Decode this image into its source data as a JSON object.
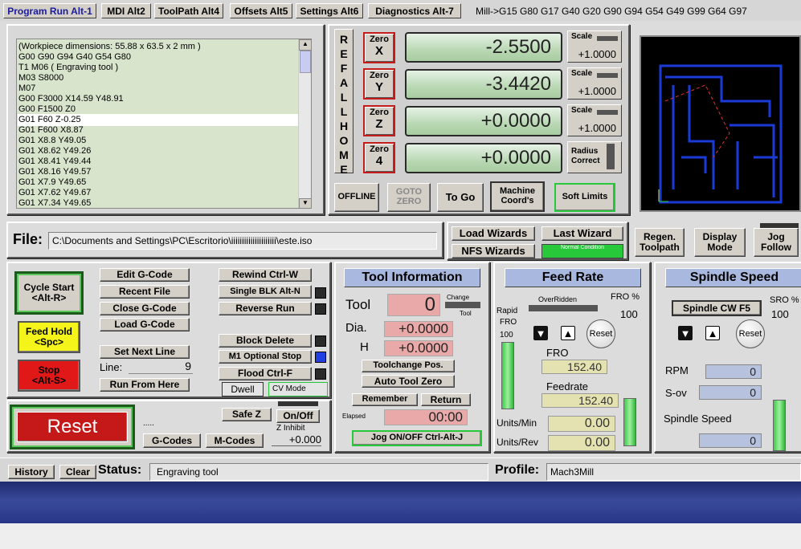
{
  "tabs": [
    {
      "label": "Program Run Alt-1"
    },
    {
      "label": "MDI Alt2"
    },
    {
      "label": "ToolPath Alt4"
    },
    {
      "label": "Offsets Alt5"
    },
    {
      "label": "Settings Alt6"
    },
    {
      "label": "Diagnostics Alt-7"
    }
  ],
  "modal_line": "Mill->G15  G80 G17 G40 G20 G90 G94 G54 G49 G99 G64 G97",
  "gcode_lines": [
    "(Workpiece dimensions: 55.88 x 63.5 x 2 mm )",
    "G00 G90 G94 G40 G54 G80",
    "T1 M06 ( Engraving tool )",
    "M03 S8000",
    "M07",
    "G00 F3000 X14.59 Y48.91",
    "G00 F1500 Z0",
    "G01 F60 Z-0.25",
    "G01 F600 X8.87",
    "G01 X8.8 Y49.05",
    "G01 X8.62 Y49.26",
    "G01 X8.41 Y49.44",
    "G01 X8.16 Y49.57",
    "G01 X7.9 Y49.65",
    "G01 X7.62 Y49.67",
    "G01 X7.34 Y49.65"
  ],
  "ref_all_home": [
    "R",
    "E",
    "F",
    "A",
    "L",
    "L",
    "H",
    "O",
    "M",
    "E"
  ],
  "axes": [
    {
      "zero_top": "Zero",
      "zero_axis": "X",
      "dro": "-2.5500",
      "scale_label": "Scale",
      "scale_value": "+1.0000"
    },
    {
      "zero_top": "Zero",
      "zero_axis": "Y",
      "dro": "-3.4420",
      "scale_label": "Scale",
      "scale_value": "+1.0000"
    },
    {
      "zero_top": "Zero",
      "zero_axis": "Z",
      "dro": "+0.0000",
      "scale_label": "Scale",
      "scale_value": "+1.0000"
    },
    {
      "zero_top": "Zero",
      "zero_axis": "4",
      "dro": "+0.0000",
      "scale_label": "",
      "scale_value": ""
    }
  ],
  "radius_correct": "Radius Correct",
  "dro_buttons": {
    "offline": "OFFLINE",
    "goto_zero": "GOTO ZERO",
    "to_go": "To Go",
    "machine_coords": "Machine Coord's",
    "soft_limits": "Soft Limits"
  },
  "file": {
    "label": "File:",
    "path": "C:\\Documents and Settings\\PC\\Escritorio\\iiiiiiiiiiiiiiiiiiiii\\este.iso"
  },
  "wizards": {
    "load": "Load Wizards",
    "last": "Last Wizard",
    "nfs": "NFS Wizards",
    "normal": "Normal Condition"
  },
  "view": {
    "regen": "Regen. Toolpath",
    "display": "Display Mode",
    "jog": "Jog Follow"
  },
  "run": {
    "cycle_start": "Cycle Start",
    "cycle_start_key": "<Alt-R>",
    "feed_hold": "Feed Hold",
    "feed_hold_key": "<Spc>",
    "stop": "Stop",
    "stop_key": "<Alt-S>",
    "edit": "Edit G-Code",
    "recent": "Recent File",
    "close": "Close G-Code",
    "load": "Load G-Code",
    "set_next": "Set Next Line",
    "line_label": "Line:",
    "line_value": "9",
    "run_from_here": "Run From Here",
    "rewind": "Rewind Ctrl-W",
    "single_blk": "Single BLK Alt-N",
    "reverse_run": "Reverse Run",
    "block_delete": "Block Delete",
    "m1_optional": "M1 Optional Stop",
    "flood": "Flood Ctrl-F",
    "dwell": "Dwell",
    "cv_mode": "CV Mode"
  },
  "reset": {
    "label": "Reset",
    "dots": ".....",
    "safe_z": "Safe Z",
    "on_off": "On/Off",
    "z_inhibit": "Z Inhibit",
    "z_inhibit_value": "+0.000",
    "gcodes": "G-Codes",
    "mcodes": "M-Codes"
  },
  "tool": {
    "title": "Tool Information",
    "tool_label": "Tool",
    "tool_value": "0",
    "change": "Change",
    "tool_small": "Tool",
    "dia_label": "Dia.",
    "dia_value": "+0.0000",
    "h_label": "H",
    "h_value": "+0.0000",
    "toolchange_pos": "Toolchange Pos.",
    "auto_tool_zero": "Auto Tool Zero",
    "remember": "Remember",
    "return": "Return",
    "elapsed_label": "Elapsed",
    "elapsed_value": "00:00",
    "jog": "Jog ON/OFF Ctrl-Alt-J"
  },
  "feed": {
    "title": "Feed Rate",
    "overridden": "OverRidden",
    "fro_pct_label": "FRO %",
    "fro_pct_value": "100",
    "rapid": "Rapid",
    "rapid_fro": "FRO",
    "rapid_value": "100",
    "reset": "Reset",
    "fro_label": "FRO",
    "fro_value": "152.40",
    "feedrate_label": "Feedrate",
    "feedrate_value": "152.40",
    "units_min_label": "Units/Min",
    "units_min_value": "0.00",
    "units_rev_label": "Units/Rev",
    "units_rev_value": "0.00"
  },
  "spindle": {
    "title": "Spindle Speed",
    "cw": "Spindle CW F5",
    "sro_label": "SRO %",
    "sro_value": "100",
    "reset": "Reset",
    "rpm_label": "RPM",
    "rpm_value": "0",
    "sov_label": "S-ov",
    "sov_value": "0",
    "speed_label": "Spindle Speed",
    "speed_value": "0"
  },
  "status": {
    "history": "History",
    "clear": "Clear",
    "status_label": "Status:",
    "status_value": "Engraving tool",
    "profile_label": "Profile:",
    "profile_value": "Mach3Mill"
  },
  "colors": {
    "accent_blue": "#1a1aa0",
    "footer_gradient_top": "#1f2a6e",
    "dro_green": "#b9d8b3",
    "led_green": "#27c83a"
  }
}
